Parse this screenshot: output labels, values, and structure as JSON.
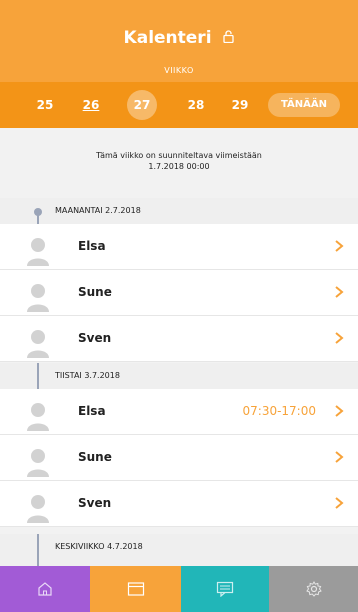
{
  "header": {
    "title": "Kalenteri",
    "subtitle": "VIIKKO"
  },
  "weeks": [
    {
      "label": "25",
      "selected": false,
      "underlined": false
    },
    {
      "label": "26",
      "selected": false,
      "underlined": true
    },
    {
      "label": "27",
      "selected": true,
      "underlined": false
    },
    {
      "label": "28",
      "selected": false,
      "underlined": false
    },
    {
      "label": "29",
      "selected": false,
      "underlined": false
    }
  ],
  "today_label": "TÄNÄÄN",
  "notice": {
    "line1": "Tämä viikko on suunniteltava viimeistään",
    "line2": "1.7.2018 00:00"
  },
  "days": [
    {
      "label": "MAANANTAI 2.7.2018",
      "people": [
        {
          "name": "Elsa",
          "time": ""
        },
        {
          "name": "Sune",
          "time": ""
        },
        {
          "name": "Sven",
          "time": ""
        }
      ]
    },
    {
      "label": "TIISTAI 3.7.2018",
      "people": [
        {
          "name": "Elsa",
          "time": "07:30-17:00"
        },
        {
          "name": "Sune",
          "time": ""
        },
        {
          "name": "Sven",
          "time": ""
        }
      ]
    },
    {
      "label": "KESKIVIIKKO 4.7.2018",
      "people": []
    }
  ],
  "tabs": [
    {
      "icon": "home-icon",
      "color": "#a25bd6"
    },
    {
      "icon": "calendar-icon",
      "color": "#f7a33a"
    },
    {
      "icon": "message-icon",
      "color": "#21b6b8"
    },
    {
      "icon": "gear-icon",
      "color": "#9b9b9b"
    }
  ],
  "colors": {
    "accent": "#f7a33a",
    "accent_dark": "#f39417"
  }
}
